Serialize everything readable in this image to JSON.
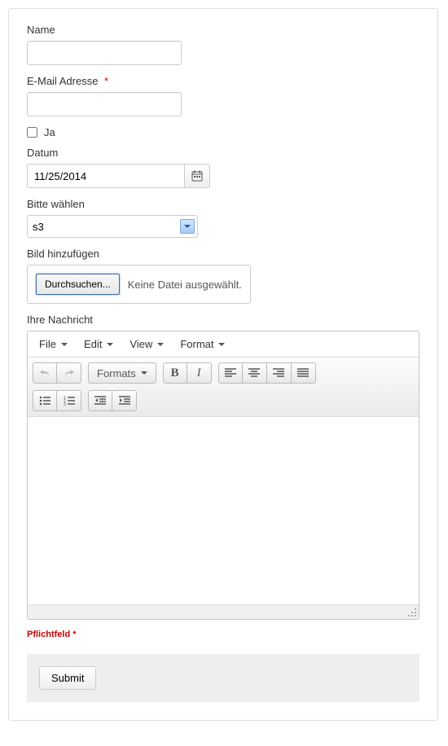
{
  "labels": {
    "name": "Name",
    "email": "E-Mail Adresse",
    "ja": "Ja",
    "datum": "Datum",
    "select": "Bitte wählen",
    "file": "Bild hinzufügen",
    "message": "Ihre Nachricht",
    "required": "Pflichtfeld *"
  },
  "values": {
    "date": "11/25/2014",
    "selectValue": "s3",
    "fileButton": "Durchsuchen...",
    "fileStatus": "Keine Datei ausgewählt."
  },
  "editor": {
    "menus": {
      "file": "File",
      "edit": "Edit",
      "view": "View",
      "format": "Format"
    },
    "formats": "Formats"
  },
  "submit": {
    "label": "Submit"
  }
}
